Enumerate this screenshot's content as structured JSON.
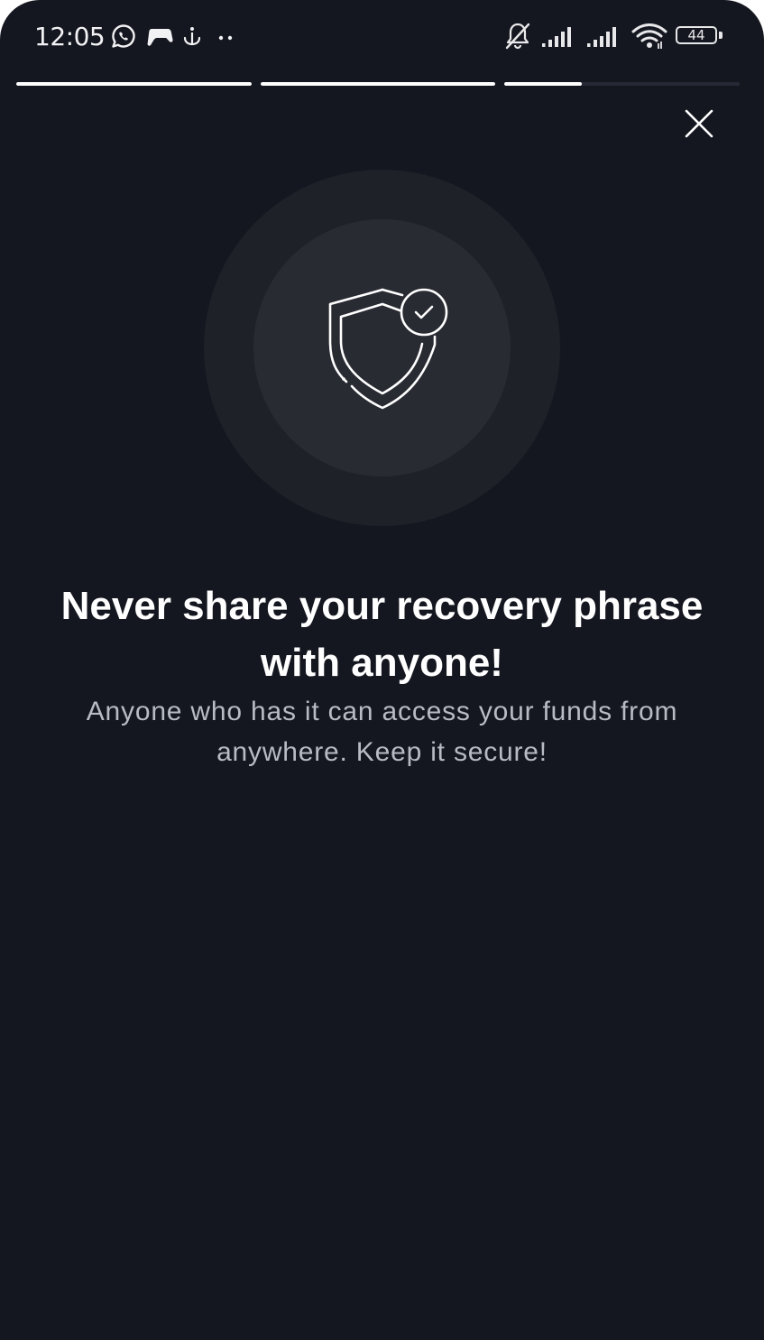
{
  "status_bar": {
    "time": "12:05",
    "battery_level": "44",
    "left_icons": [
      "whatsapp-icon",
      "game-controller-icon",
      "anchor-icon",
      "more-dots-icon"
    ],
    "right_icons": [
      "bell-muted-icon",
      "signal-icon",
      "signal-icon",
      "wifi-icon",
      "battery-icon"
    ]
  },
  "progress": {
    "steps": [
      {
        "fill": 1.0
      },
      {
        "fill": 1.0
      },
      {
        "fill": 0.33
      }
    ]
  },
  "close_button": {
    "icon": "close-icon"
  },
  "hero": {
    "icon": "shield-check-icon"
  },
  "content": {
    "title": "Never share your recovery phrase with anyone!",
    "subtitle": "Anyone who has it can access your funds from anywhere. Keep it secure!"
  },
  "colors": {
    "background": "#151720",
    "outer_circle": "#1f2129",
    "inner_circle": "#292b33",
    "progress_active": "#ffffff",
    "progress_track": "#262935",
    "title": "#ffffff",
    "subtitle": "#b9bbc4"
  }
}
